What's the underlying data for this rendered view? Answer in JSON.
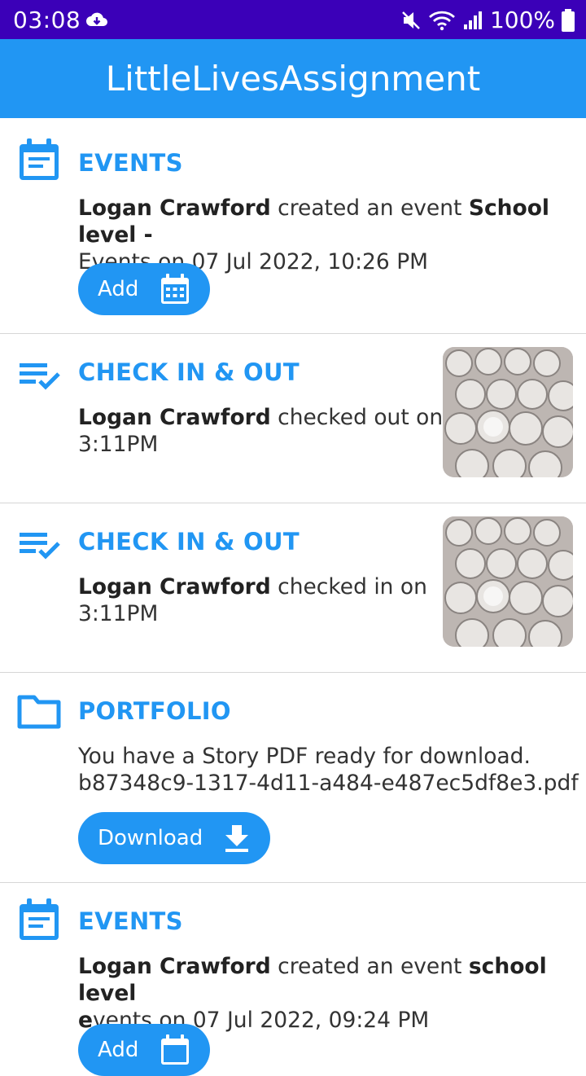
{
  "status_bar": {
    "time": "03:08",
    "battery": "100%"
  },
  "app_bar": {
    "title": "LittleLivesAssignment"
  },
  "feed": [
    {
      "title": "EVENTS",
      "actor": "Logan Crawford",
      "action": " created an event ",
      "subject": "School level -",
      "line2": "Events on 07 Jul 2022, 10:26 PM",
      "button": "Add"
    },
    {
      "title": "CHECK IN & OUT",
      "actor": "Logan Crawford",
      "action": " checked out on",
      "line2": "3:11PM"
    },
    {
      "title": "CHECK IN & OUT",
      "actor": "Logan Crawford",
      "action": " checked in on",
      "line2": "3:11PM"
    },
    {
      "title": "PORTFOLIO",
      "line1": "You have a Story PDF ready for download.",
      "line2": "b87348c9-1317-4d11-a484-e487ec5df8e3.pdf",
      "button": "Download"
    },
    {
      "title": "EVENTS",
      "actor": "Logan Crawford",
      "action": " created an event ",
      "subject": "school level",
      "line2_bold": "e",
      "line2": "vents on 07 Jul 2022, 09:24 PM",
      "button": "Add"
    }
  ]
}
